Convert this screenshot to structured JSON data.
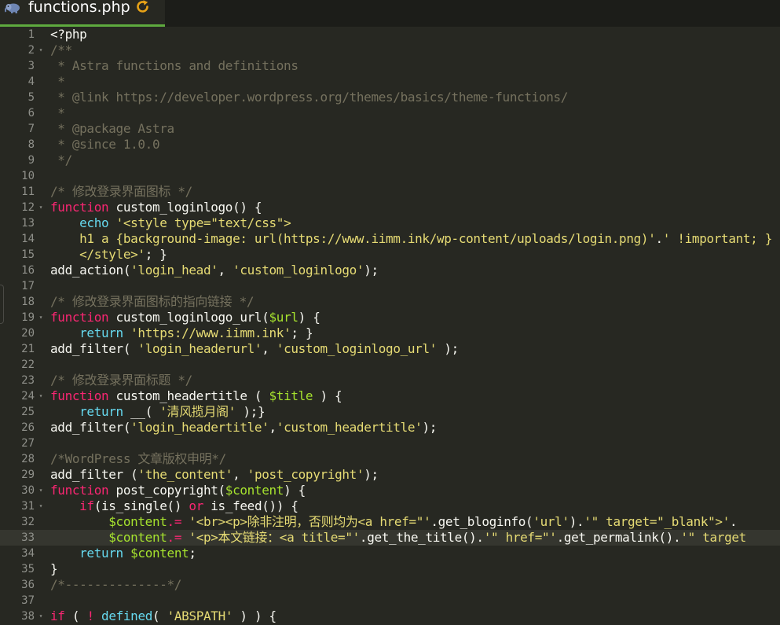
{
  "tab": {
    "icon": "php-elephant-icon",
    "title": "functions.php",
    "status_icon": "refresh-icon",
    "accent": "#5eaa3e"
  },
  "theme": {
    "background": "#272822",
    "comment": "#75715e",
    "keyword": "#f92672",
    "string": "#e6db74",
    "variable": "#a6e22e",
    "builtin": "#66d9ef",
    "plain": "#f8f8f2",
    "gutter_text": "#8f908a",
    "active_line": "#35362f"
  },
  "editor": {
    "active_line": 33,
    "lines": [
      {
        "num": "1",
        "fold": false,
        "tokens": [
          {
            "t": "plain",
            "v": "<?php"
          }
        ]
      },
      {
        "num": "2",
        "fold": true,
        "tokens": [
          {
            "t": "comment",
            "v": "/**"
          }
        ]
      },
      {
        "num": "3",
        "fold": false,
        "tokens": [
          {
            "t": "comment",
            "v": " * Astra functions and definitions"
          }
        ]
      },
      {
        "num": "4",
        "fold": false,
        "tokens": [
          {
            "t": "comment",
            "v": " *"
          }
        ]
      },
      {
        "num": "5",
        "fold": false,
        "tokens": [
          {
            "t": "comment",
            "v": " * @link https://developer.wordpress.org/themes/basics/theme-functions/"
          }
        ]
      },
      {
        "num": "6",
        "fold": false,
        "tokens": [
          {
            "t": "comment",
            "v": " *"
          }
        ]
      },
      {
        "num": "7",
        "fold": false,
        "tokens": [
          {
            "t": "comment",
            "v": " * @package Astra"
          }
        ]
      },
      {
        "num": "8",
        "fold": false,
        "tokens": [
          {
            "t": "comment",
            "v": " * @since 1.0.0"
          }
        ]
      },
      {
        "num": "9",
        "fold": false,
        "tokens": [
          {
            "t": "comment",
            "v": " */"
          }
        ]
      },
      {
        "num": "10",
        "fold": false,
        "tokens": []
      },
      {
        "num": "11",
        "fold": false,
        "tokens": [
          {
            "t": "comment",
            "v": "/* 修改登录界面图标 */"
          }
        ]
      },
      {
        "num": "12",
        "fold": true,
        "tokens": [
          {
            "t": "keyword",
            "v": "function"
          },
          {
            "t": "plain",
            "v": " custom_loginlogo() {"
          }
        ]
      },
      {
        "num": "13",
        "fold": false,
        "tokens": [
          {
            "t": "plain",
            "v": "    "
          },
          {
            "t": "builtin",
            "v": "echo"
          },
          {
            "t": "plain",
            "v": " "
          },
          {
            "t": "string",
            "v": "'<style type=\"text/css\">"
          }
        ]
      },
      {
        "num": "14",
        "fold": false,
        "tokens": [
          {
            "t": "string",
            "v": "    h1 a {background-image: url(https://www.iimm.ink/wp-content/uploads/login.png)'"
          },
          {
            "t": "plain",
            "v": "."
          },
          {
            "t": "string",
            "v": "' !important; }"
          }
        ]
      },
      {
        "num": "15",
        "fold": false,
        "tokens": [
          {
            "t": "string",
            "v": "    </style>'"
          },
          {
            "t": "plain",
            "v": "; }"
          }
        ]
      },
      {
        "num": "16",
        "fold": false,
        "tokens": [
          {
            "t": "plain",
            "v": "add_action("
          },
          {
            "t": "string",
            "v": "'login_head'"
          },
          {
            "t": "plain",
            "v": ", "
          },
          {
            "t": "string",
            "v": "'custom_loginlogo'"
          },
          {
            "t": "plain",
            "v": ");"
          }
        ]
      },
      {
        "num": "17",
        "fold": false,
        "tokens": []
      },
      {
        "num": "18",
        "fold": false,
        "tokens": [
          {
            "t": "comment",
            "v": "/* 修改登录界面图标的指向链接 */"
          }
        ]
      },
      {
        "num": "19",
        "fold": true,
        "tokens": [
          {
            "t": "keyword",
            "v": "function"
          },
          {
            "t": "plain",
            "v": " custom_loginlogo_url("
          },
          {
            "t": "variable",
            "v": "$url"
          },
          {
            "t": "plain",
            "v": ") {"
          }
        ]
      },
      {
        "num": "20",
        "fold": false,
        "tokens": [
          {
            "t": "plain",
            "v": "    "
          },
          {
            "t": "builtin",
            "v": "return"
          },
          {
            "t": "plain",
            "v": " "
          },
          {
            "t": "string",
            "v": "'https://www.iimm.ink'"
          },
          {
            "t": "plain",
            "v": "; }"
          }
        ]
      },
      {
        "num": "21",
        "fold": false,
        "tokens": [
          {
            "t": "plain",
            "v": "add_filter( "
          },
          {
            "t": "string",
            "v": "'login_headerurl'"
          },
          {
            "t": "plain",
            "v": ", "
          },
          {
            "t": "string",
            "v": "'custom_loginlogo_url'"
          },
          {
            "t": "plain",
            "v": " );"
          }
        ]
      },
      {
        "num": "22",
        "fold": false,
        "tokens": []
      },
      {
        "num": "23",
        "fold": false,
        "tokens": [
          {
            "t": "comment",
            "v": "/* 修改登录界面标题 */"
          }
        ]
      },
      {
        "num": "24",
        "fold": true,
        "tokens": [
          {
            "t": "keyword",
            "v": "function"
          },
          {
            "t": "plain",
            "v": " custom_headertitle ( "
          },
          {
            "t": "variable",
            "v": "$title"
          },
          {
            "t": "plain",
            "v": " ) {"
          }
        ]
      },
      {
        "num": "25",
        "fold": false,
        "tokens": [
          {
            "t": "plain",
            "v": "    "
          },
          {
            "t": "builtin",
            "v": "return"
          },
          {
            "t": "plain",
            "v": " __( "
          },
          {
            "t": "string",
            "v": "'清风揽月阁'"
          },
          {
            "t": "plain",
            "v": " );}"
          }
        ]
      },
      {
        "num": "26",
        "fold": false,
        "tokens": [
          {
            "t": "plain",
            "v": "add_filter("
          },
          {
            "t": "string",
            "v": "'login_headertitle'"
          },
          {
            "t": "plain",
            "v": ","
          },
          {
            "t": "string",
            "v": "'custom_headertitle'"
          },
          {
            "t": "plain",
            "v": ");"
          }
        ]
      },
      {
        "num": "27",
        "fold": false,
        "tokens": []
      },
      {
        "num": "28",
        "fold": false,
        "tokens": [
          {
            "t": "comment",
            "v": "/*WordPress 文章版权申明*/"
          }
        ]
      },
      {
        "num": "29",
        "fold": false,
        "tokens": [
          {
            "t": "plain",
            "v": "add_filter ("
          },
          {
            "t": "string",
            "v": "'the_content'"
          },
          {
            "t": "plain",
            "v": ", "
          },
          {
            "t": "string",
            "v": "'post_copyright'"
          },
          {
            "t": "plain",
            "v": ");"
          }
        ]
      },
      {
        "num": "30",
        "fold": true,
        "tokens": [
          {
            "t": "keyword",
            "v": "function"
          },
          {
            "t": "plain",
            "v": " post_copyright("
          },
          {
            "t": "variable",
            "v": "$content"
          },
          {
            "t": "plain",
            "v": ") {"
          }
        ]
      },
      {
        "num": "31",
        "fold": true,
        "tokens": [
          {
            "t": "plain",
            "v": "    "
          },
          {
            "t": "keyword",
            "v": "if"
          },
          {
            "t": "plain",
            "v": "(is_single() "
          },
          {
            "t": "keyword",
            "v": "or"
          },
          {
            "t": "plain",
            "v": " is_feed()) {"
          }
        ]
      },
      {
        "num": "32",
        "fold": false,
        "tokens": [
          {
            "t": "plain",
            "v": "        "
          },
          {
            "t": "variable",
            "v": "$content"
          },
          {
            "t": "keyword",
            "v": ".="
          },
          {
            "t": "plain",
            "v": " "
          },
          {
            "t": "string",
            "v": "'<br><p>除非注明，否则均为<a href=\"'"
          },
          {
            "t": "plain",
            "v": ".get_bloginfo("
          },
          {
            "t": "string",
            "v": "'url'"
          },
          {
            "t": "plain",
            "v": ")."
          },
          {
            "t": "string",
            "v": "'\" target=\"_blank\">'"
          },
          {
            "t": "plain",
            "v": "."
          }
        ]
      },
      {
        "num": "33",
        "fold": false,
        "tokens": [
          {
            "t": "plain",
            "v": "        "
          },
          {
            "t": "variable",
            "v": "$content"
          },
          {
            "t": "keyword",
            "v": ".="
          },
          {
            "t": "plain",
            "v": " "
          },
          {
            "t": "string",
            "v": "'<p>本文链接：<a title=\"'"
          },
          {
            "t": "plain",
            "v": ".get_the_title()."
          },
          {
            "t": "string",
            "v": "'\" href=\"'"
          },
          {
            "t": "plain",
            "v": ".get_permalink()."
          },
          {
            "t": "string",
            "v": "'\" target"
          }
        ]
      },
      {
        "num": "34",
        "fold": false,
        "tokens": [
          {
            "t": "plain",
            "v": "    "
          },
          {
            "t": "builtin",
            "v": "return"
          },
          {
            "t": "plain",
            "v": " "
          },
          {
            "t": "variable",
            "v": "$content"
          },
          {
            "t": "plain",
            "v": ";"
          }
        ]
      },
      {
        "num": "35",
        "fold": false,
        "tokens": [
          {
            "t": "plain",
            "v": "}"
          }
        ]
      },
      {
        "num": "36",
        "fold": false,
        "tokens": [
          {
            "t": "comment",
            "v": "/*--------------*/"
          }
        ]
      },
      {
        "num": "37",
        "fold": false,
        "tokens": []
      },
      {
        "num": "38",
        "fold": true,
        "tokens": [
          {
            "t": "keyword",
            "v": "if"
          },
          {
            "t": "plain",
            "v": " ( "
          },
          {
            "t": "keyword",
            "v": "!"
          },
          {
            "t": "plain",
            "v": " "
          },
          {
            "t": "builtin",
            "v": "defined"
          },
          {
            "t": "plain",
            "v": "( "
          },
          {
            "t": "string",
            "v": "'ABSPATH'"
          },
          {
            "t": "plain",
            "v": " ) ) {"
          }
        ]
      }
    ]
  }
}
